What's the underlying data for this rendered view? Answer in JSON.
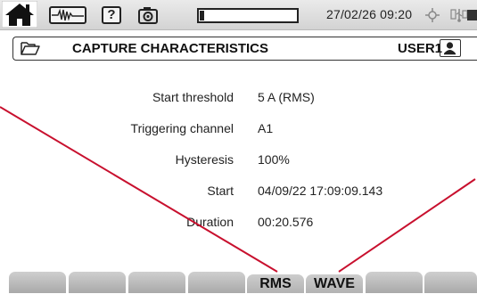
{
  "statusbar": {
    "icons": [
      "home-icon",
      "waveform-icon",
      "help-icon",
      "camera-icon",
      "battery-icon",
      "gps-icon",
      "network-icon",
      "power-icon"
    ],
    "help_label": "?",
    "battery_level": 0.05,
    "datetime": "27/02/26 09:20"
  },
  "titlebar": {
    "icon": "folder-icon",
    "title": "CAPTURE CHARACTERISTICS",
    "user": "USER1",
    "user_icon": "user-icon"
  },
  "details": {
    "rows": [
      {
        "label": "Start threshold",
        "value": "5  A (RMS)"
      },
      {
        "label": "Triggering channel",
        "value": "A1"
      },
      {
        "label": "Hysteresis",
        "value": "100%"
      },
      {
        "label": "Start",
        "value": "04/09/22  17:09:09.143"
      },
      {
        "label": "Duration",
        "value": "00:20.576"
      }
    ]
  },
  "softkeys": [
    {
      "label": ""
    },
    {
      "label": ""
    },
    {
      "label": ""
    },
    {
      "label": ""
    },
    {
      "label": "RMS"
    },
    {
      "label": "WAVE"
    },
    {
      "label": ""
    },
    {
      "label": ""
    }
  ],
  "colors": {
    "annotation_line": "#c8102e",
    "softkey": "#b8b8b8"
  }
}
